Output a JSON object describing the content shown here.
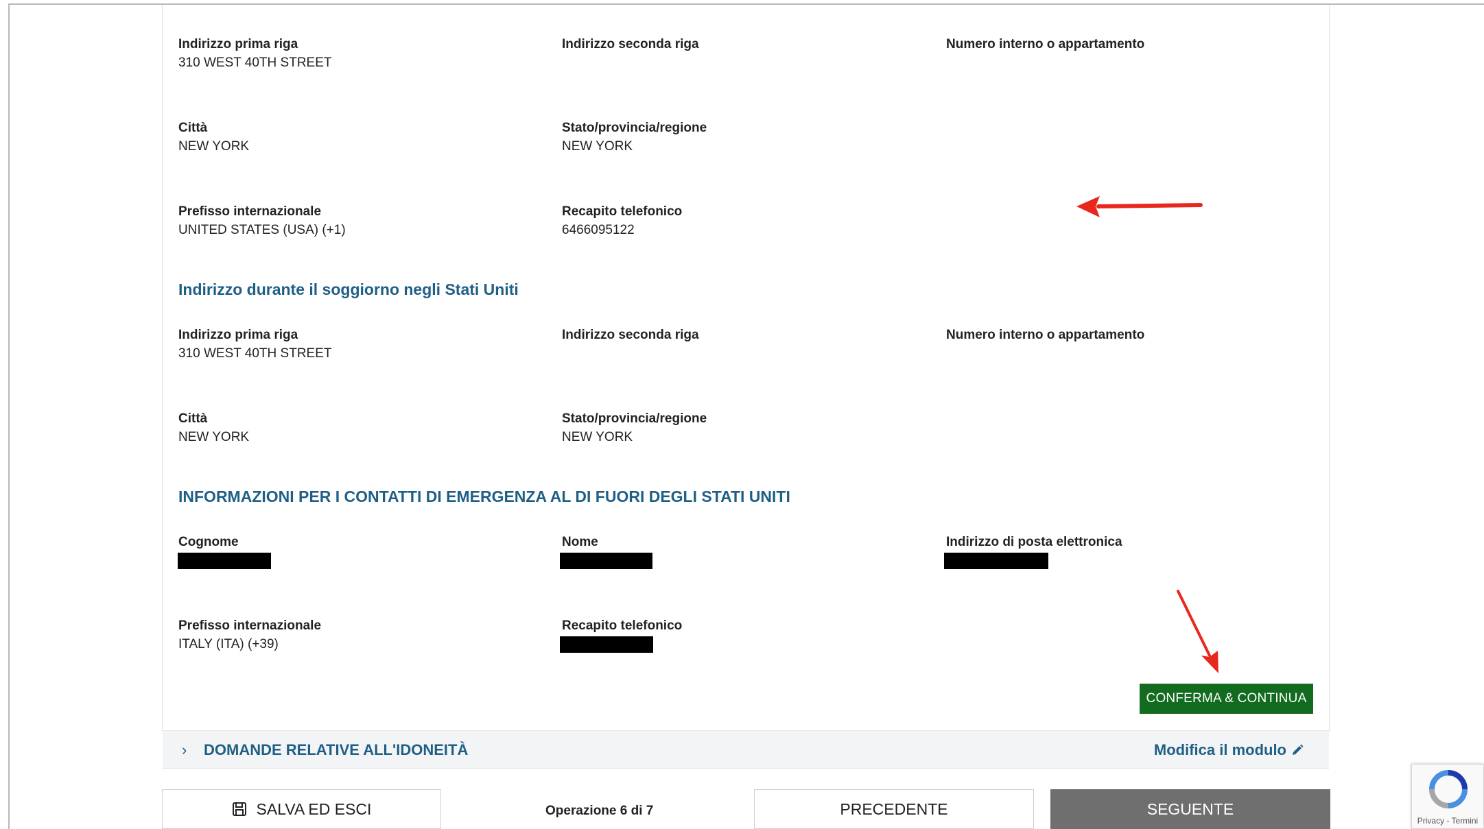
{
  "home_address": {
    "line1_label": "Indirizzo prima riga",
    "line1_value": "310 WEST 40TH STREET",
    "line2_label": "Indirizzo seconda riga",
    "apt_label": "Numero interno o appartamento",
    "city_label": "Città",
    "city_value": "NEW YORK",
    "state_label": "Stato/provincia/regione",
    "state_value": "NEW YORK",
    "country_code_label": "Prefisso internazionale",
    "country_code_value": "UNITED STATES (USA) (+1)",
    "phone_label": "Recapito telefonico",
    "phone_value": "6466095122"
  },
  "us_stay": {
    "heading": "Indirizzo durante il soggiorno negli Stati Uniti",
    "line1_label": "Indirizzo prima riga",
    "line1_value": "310 WEST 40TH STREET",
    "line2_label": "Indirizzo seconda riga",
    "apt_label": "Numero interno o appartamento",
    "city_label": "Città",
    "city_value": "NEW YORK",
    "state_label": "Stato/provincia/regione",
    "state_value": "NEW YORK"
  },
  "emergency": {
    "heading": "INFORMAZIONI PER I CONTATTI DI EMERGENZA AL DI FUORI DEGLI STATI UNITI",
    "surname_label": "Cognome",
    "name_label": "Nome",
    "email_label": "Indirizzo di posta elettronica",
    "country_code_label": "Prefisso internazionale",
    "country_code_value": "ITALY (ITA) (+39)",
    "phone_label": "Recapito telefonico"
  },
  "confirm_button": "CONFERMA & CONTINUA",
  "accordion": {
    "chevron": "›",
    "title": "DOMANDE RELATIVE ALL'IDONEITÀ",
    "edit_label": "Modifica il modulo"
  },
  "footer": {
    "save_label": "SALVA ED ESCI",
    "step_text": "Operazione 6 di 7",
    "prev_label": "PRECEDENTE",
    "next_label": "SEGUENTE"
  },
  "captcha": {
    "links": "Privacy - Termini"
  },
  "colors": {
    "section_heading": "#1f5f86",
    "confirm_button": "#126b1f",
    "next_button": "#6f6f6f",
    "annotation_arrow": "#e8281e"
  },
  "icons": {
    "save": "floppy-disk-icon",
    "edit": "pencil-icon",
    "chevron": "chevron-right-icon",
    "captcha": "recaptcha-logo-icon"
  }
}
